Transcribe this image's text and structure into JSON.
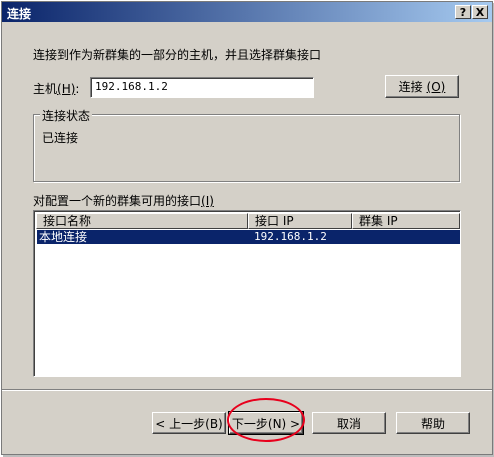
{
  "dialog": {
    "title": "连接",
    "help_glyph": "?",
    "close_glyph": "X"
  },
  "intro": "连接到作为新群集的一部分的主机，并且选择群集接口",
  "host": {
    "label": "主机",
    "mnemonic": "(H)",
    "colon": ":",
    "value": "192.168.1.2",
    "connect_label": "连接",
    "connect_mnemonic": "(O)"
  },
  "status": {
    "legend": "连接状态",
    "text": "已连接"
  },
  "interfaces": {
    "label": "对配置一个新的群集可用的接口",
    "mnemonic": "(I)",
    "columns": [
      "接口名称",
      "接口 IP",
      "群集 IP"
    ],
    "rows": [
      {
        "name": "本地连接",
        "ip": "192.168.1.2",
        "cluster_ip": ""
      }
    ]
  },
  "buttons": {
    "back": "< 上一步(B)",
    "next": "下一步(N) >",
    "cancel": "取消",
    "help": "帮助"
  },
  "colors": {
    "title_start": "#0a246a",
    "title_end": "#a6caf0",
    "selection": "#0a246a",
    "annotation_circle": "#e8001c",
    "dialog_face": "#d4d0c8"
  }
}
